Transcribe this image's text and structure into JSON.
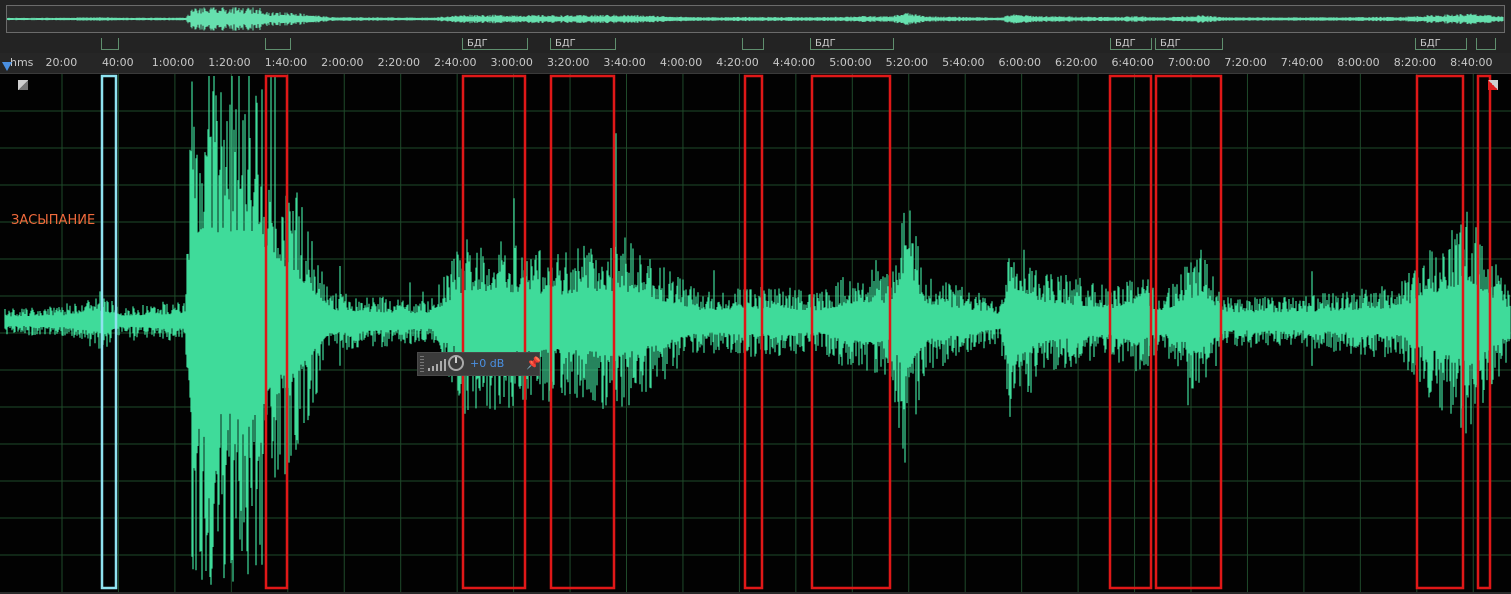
{
  "colors": {
    "waveform": "#3fdb9a",
    "waveform_overview": "#66e0ae",
    "stage_box": "#e01818",
    "sleep_onset_box": "#8fe3f0",
    "caption": "#f06a3c",
    "marker_flag": "#5f8f6e",
    "grid": "#1f4a2a"
  },
  "timeline": {
    "unit_label": "hms",
    "tick_labels": [
      "20:00",
      "40:00",
      "1:00:00",
      "1:20:00",
      "1:40:00",
      "2:00:00",
      "2:20:00",
      "2:40:00",
      "3:00:00",
      "3:20:00",
      "3:40:00",
      "4:00:00",
      "4:20:00",
      "4:40:00",
      "5:00:00",
      "5:20:00",
      "5:40:00",
      "6:00:00",
      "6:20:00",
      "6:40:00",
      "7:00:00",
      "7:20:00",
      "7:40:00",
      "8:00:00",
      "8:20:00",
      "8:40:00"
    ]
  },
  "markers": [
    {
      "label": ""
    },
    {
      "label": ""
    },
    {
      "label": "БДГ"
    },
    {
      "label": "БДГ"
    },
    {
      "label": ""
    },
    {
      "label": "БДГ"
    },
    {
      "label": "БДГ"
    },
    {
      "label": "БДГ"
    },
    {
      "label": "БДГ"
    },
    {
      "label": ""
    }
  ],
  "annotation": {
    "caption": "ЗАСЫПАНИЕ"
  },
  "gain_hud": {
    "gain_label": "+0 dB",
    "level_icon": "level-meter-icon",
    "knob_icon": "volume-knob-icon",
    "pin_icon": "pin-icon"
  }
}
